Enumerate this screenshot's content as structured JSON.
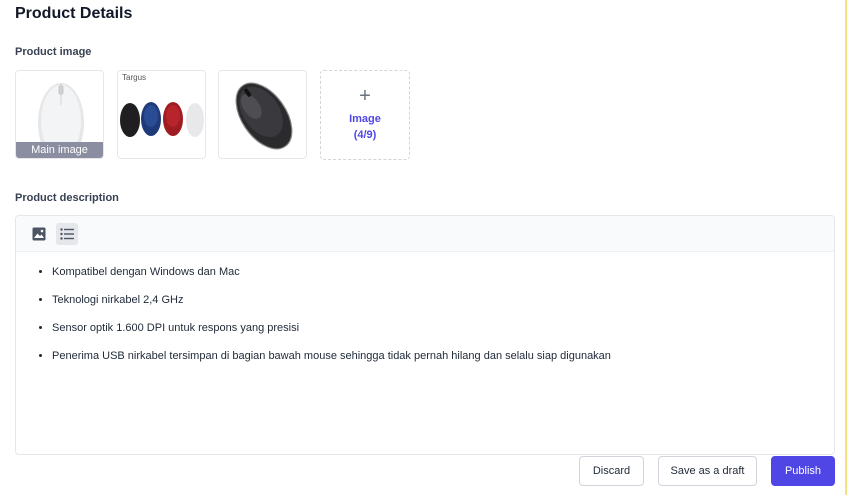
{
  "page": {
    "title": "Product Details"
  },
  "images": {
    "label": "Product image",
    "main_tag": "Main image",
    "thumb2_brand": "Targus",
    "add_label": "Image",
    "add_count": "(4/9)"
  },
  "description": {
    "label": "Product description",
    "bullets": [
      "Kompatibel dengan Windows dan Mac",
      "Teknologi nirkabel 2,4 GHz",
      "Sensor optik 1.600 DPI untuk respons yang presisi",
      "Penerima USB nirkabel tersimpan di bagian bawah mouse sehingga tidak pernah hilang dan selalu siap digunakan"
    ]
  },
  "actions": {
    "discard": "Discard",
    "save_draft": "Save as a draft",
    "publish": "Publish"
  },
  "colors": {
    "accent": "#4f46e5"
  }
}
